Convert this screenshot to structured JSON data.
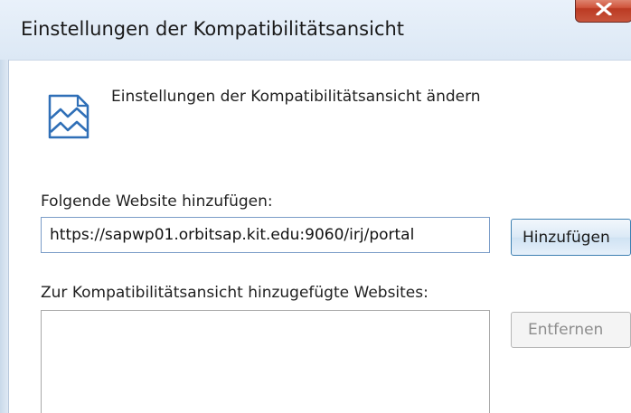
{
  "window": {
    "title": "Einstellungen der Kompatibilitätsansicht",
    "close_icon": "close-x-icon"
  },
  "header": {
    "icon": "compatibility-view-icon",
    "text": "Einstellungen der Kompatibilitätsansicht ändern"
  },
  "add_section": {
    "label": "Folgende Website hinzufügen:",
    "input_value": "https://sapwp01.orbitsap.kit.edu:9060/irj/portal",
    "add_button_label": "Hinzufügen"
  },
  "list_section": {
    "label": "Zur Kompatibilitätsansicht hinzugefügte Websites:",
    "items": [],
    "remove_button_label": "Entfernen",
    "remove_button_enabled": false
  },
  "colors": {
    "close_button": "#c8553c",
    "accent_border": "#3c7fb1",
    "icon_blue": "#2f6fb7"
  }
}
